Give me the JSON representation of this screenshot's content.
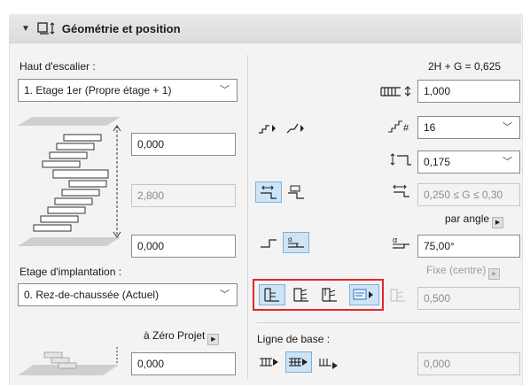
{
  "panel": {
    "title": "Géométrie et position",
    "collapse_icon": "triangle-down-icon",
    "title_icon": "stair-geometry-icon"
  },
  "left": {
    "top_level_label": "Haut d'escalier :",
    "top_level_value": "1. Etage 1er (Propre étage + 1)",
    "top_offset": "0,000",
    "height_value": "2,800",
    "bottom_offset": "0,000",
    "home_story_label": "Etage d'implantation :",
    "home_story_value": "0. Rez-de-chaussée (Actuel)",
    "reference_label": "à Zéro Projet",
    "reference_value": "0,000"
  },
  "right": {
    "formula": "2H + G = 0,625",
    "flight_width": "1,000",
    "num_risers": "16",
    "riser_height": "0,175",
    "going_depth": "0,250 ≤ G ≤ 0,30",
    "angle_mode_label": "par angle",
    "angle_value": "75,00°",
    "position_mode_label": "Fixe (centre)",
    "position_value": "0,500",
    "baseline_label": "Ligne de base :",
    "baseline_value": "0,000"
  },
  "colors": {
    "highlight": "#e4262b",
    "selected_bg": "#cde4f7",
    "selected_border": "#7fb0da"
  }
}
